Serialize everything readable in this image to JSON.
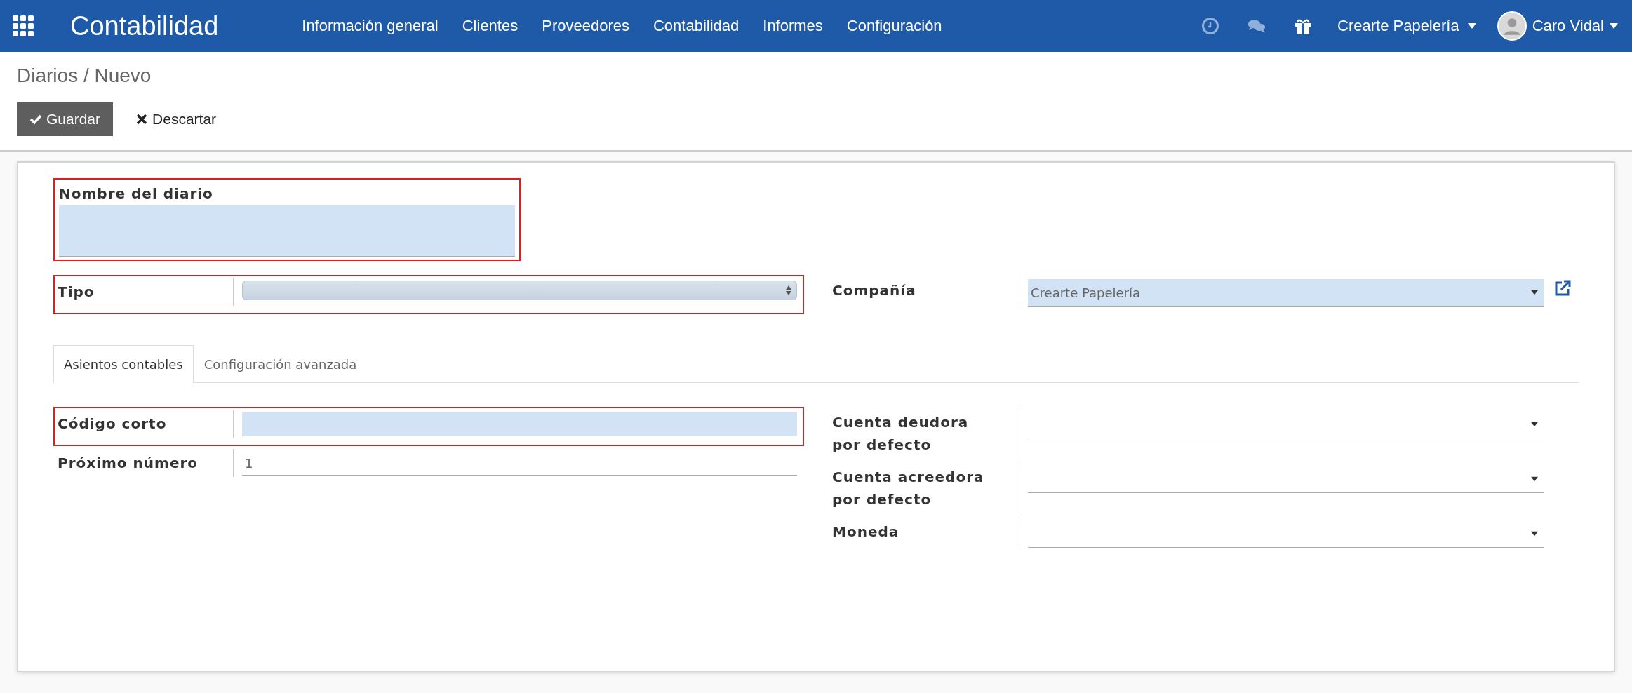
{
  "navbar": {
    "brand": "Contabilidad",
    "menu": [
      {
        "label": "Información general"
      },
      {
        "label": "Clientes"
      },
      {
        "label": "Proveedores"
      },
      {
        "label": "Contabilidad"
      },
      {
        "label": "Informes"
      },
      {
        "label": "Configuración"
      }
    ],
    "company": "Crearte Papelería",
    "user": "Caro Vidal"
  },
  "breadcrumb": {
    "parent": "Diarios",
    "separator": "/",
    "current": "Nuevo"
  },
  "buttons": [
    {
      "label": "Guardar",
      "kind": "primary"
    },
    {
      "label": "Descartar",
      "kind": "secondary"
    }
  ],
  "form": {
    "title_field": {
      "label": "Nombre del diario",
      "required": true,
      "highlighted": true
    },
    "left_fields": [
      {
        "label": "Tipo",
        "kind": "select",
        "required": true,
        "highlighted": true
      }
    ],
    "right_fields": [
      {
        "label": "Compañía",
        "kind": "many2one",
        "value": "Crearte Papelería",
        "required": true,
        "highlighted": false,
        "external_link": true
      }
    ],
    "tabs": [
      {
        "label": "Asientos contables",
        "selected": true
      },
      {
        "label": "Configuración avanzada",
        "selected": false
      }
    ],
    "tab_left_fields": [
      {
        "label": "Código corto",
        "kind": "char",
        "required": true,
        "highlighted": true
      },
      {
        "label": "Próximo número",
        "kind": "char",
        "value": "1",
        "required": false,
        "highlighted": false
      }
    ],
    "tab_right_fields": [
      {
        "label": "Cuenta deudora por defecto",
        "kind": "many2one",
        "required": false,
        "highlighted": false
      },
      {
        "label": "Cuenta acreedora por defecto",
        "kind": "many2one",
        "required": false,
        "highlighted": false
      },
      {
        "label": "Moneda",
        "kind": "many2one",
        "required": false,
        "highlighted": false
      }
    ]
  }
}
